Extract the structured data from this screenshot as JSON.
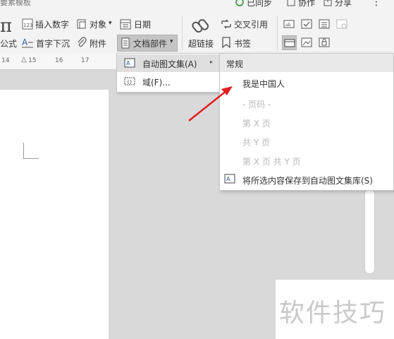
{
  "ribbon": {
    "top_partial_label": "要素模板",
    "sync_label": "已同步",
    "collab_label": "协作",
    "share_label": "分享",
    "more_label": "⋮",
    "formula_label": "公式",
    "insert_number_label": "插入数字",
    "object_label": "对象",
    "date_label": "日期",
    "dropcap_label": "首字下沉",
    "attachment_label": "附件",
    "doc_parts_label": "文档部件",
    "hyperlink_label": "超链接",
    "crossref_label": "交叉引用",
    "bookmark_label": "书签"
  },
  "ruler": {
    "ticks": [
      "14",
      "15",
      "16",
      "17"
    ]
  },
  "menu1": {
    "items": [
      {
        "label": "自动图文集(A)"
      },
      {
        "label": "域(F)..."
      }
    ]
  },
  "menu2": {
    "header": "常规",
    "items": [
      {
        "label": "我是中国人",
        "enabled": true
      },
      {
        "label": "- 页码 -",
        "enabled": false
      },
      {
        "label": "第 X 页",
        "enabled": false
      },
      {
        "label": "共 Y 页",
        "enabled": false
      },
      {
        "label": "第 X 页 共 Y 页",
        "enabled": false
      },
      {
        "label": "将所选内容保存到自动图文集库(S)",
        "enabled": true
      }
    ]
  },
  "watermark": "软件技巧",
  "colors": {
    "arrow": "#e02020",
    "highlight": "#dfdfdf",
    "menu_header": "#e9e9e9"
  }
}
